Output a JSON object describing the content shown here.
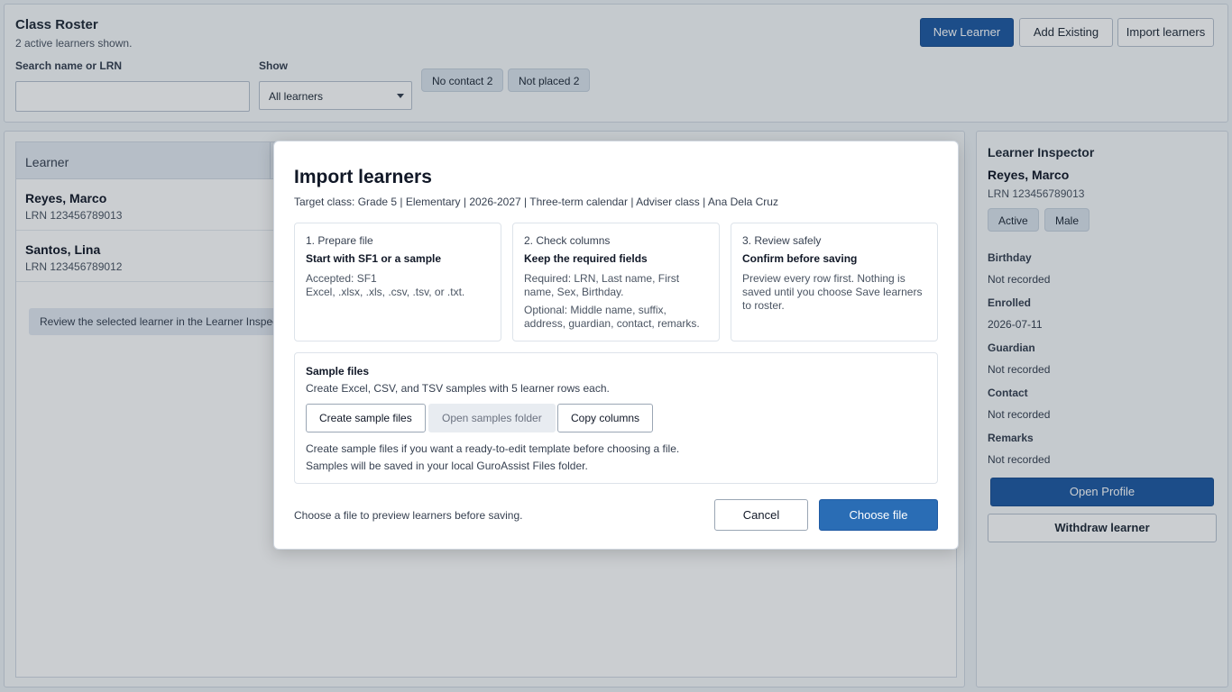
{
  "header": {
    "title": "Class Roster",
    "subtitle": "2 active learners shown.",
    "search_label": "Search name or LRN",
    "search_value": "",
    "show_label": "Show",
    "show_value": "All learners",
    "chips": [
      "No contact 2",
      "Not placed 2"
    ],
    "buttons": {
      "new": "New Learner",
      "add_existing": "Add Existing",
      "import": "Import learners"
    }
  },
  "list": {
    "column_header": "Learner",
    "rows": [
      {
        "name": "Reyes, Marco",
        "lrn": "LRN 123456789013"
      },
      {
        "name": "Santos, Lina",
        "lrn": "LRN 123456789012"
      }
    ],
    "hint": "Review the selected learner in the Learner Inspector"
  },
  "inspector": {
    "title": "Learner Inspector",
    "name": "Reyes, Marco",
    "lrn": "LRN 123456789013",
    "badges": [
      "Active",
      "Male"
    ],
    "fields": [
      {
        "label": "Birthday",
        "value": "Not recorded"
      },
      {
        "label": "Enrolled",
        "value": "2026-07-11"
      },
      {
        "label": "Guardian",
        "value": "Not recorded"
      },
      {
        "label": "Contact",
        "value": "Not recorded"
      },
      {
        "label": "Remarks",
        "value": "Not recorded"
      }
    ],
    "open_profile": "Open Profile",
    "withdraw": "Withdraw learner"
  },
  "modal": {
    "title": "Import learners",
    "target": "Target class: Grade 5 | Elementary | 2026-2027 | Three-term calendar | Adviser class | Ana Dela Cruz",
    "cards": [
      {
        "step": "1. Prepare file",
        "heading": "Start with SF1 or a sample",
        "line1": "Accepted: SF1",
        "line2": "Excel, .xlsx, .xls, .csv, .tsv, or .txt.",
        "extra": ""
      },
      {
        "step": "2. Check columns",
        "heading": "Keep the required fields",
        "line1": "Required: LRN, Last name, First name, Sex, Birthday.",
        "line2": "",
        "extra": "Optional: Middle name, suffix, address, guardian, contact, remarks."
      },
      {
        "step": "3. Review safely",
        "heading": "Confirm before saving",
        "line1": "Preview every row first. Nothing is saved until you choose Save learners to roster.",
        "line2": "",
        "extra": ""
      }
    ],
    "samples": {
      "title": "Sample files",
      "desc": "Create Excel, CSV, and TSV samples with 5 learner rows each.",
      "create": "Create sample files",
      "open": "Open samples folder",
      "copy": "Copy columns",
      "note1": "Create sample files if you want a ready-to-edit template before choosing a file.",
      "note2": "Samples will be saved in your local GuroAssist Files folder."
    },
    "footer_text": "Choose a file to preview learners before saving.",
    "cancel": "Cancel",
    "choose": "Choose file"
  }
}
